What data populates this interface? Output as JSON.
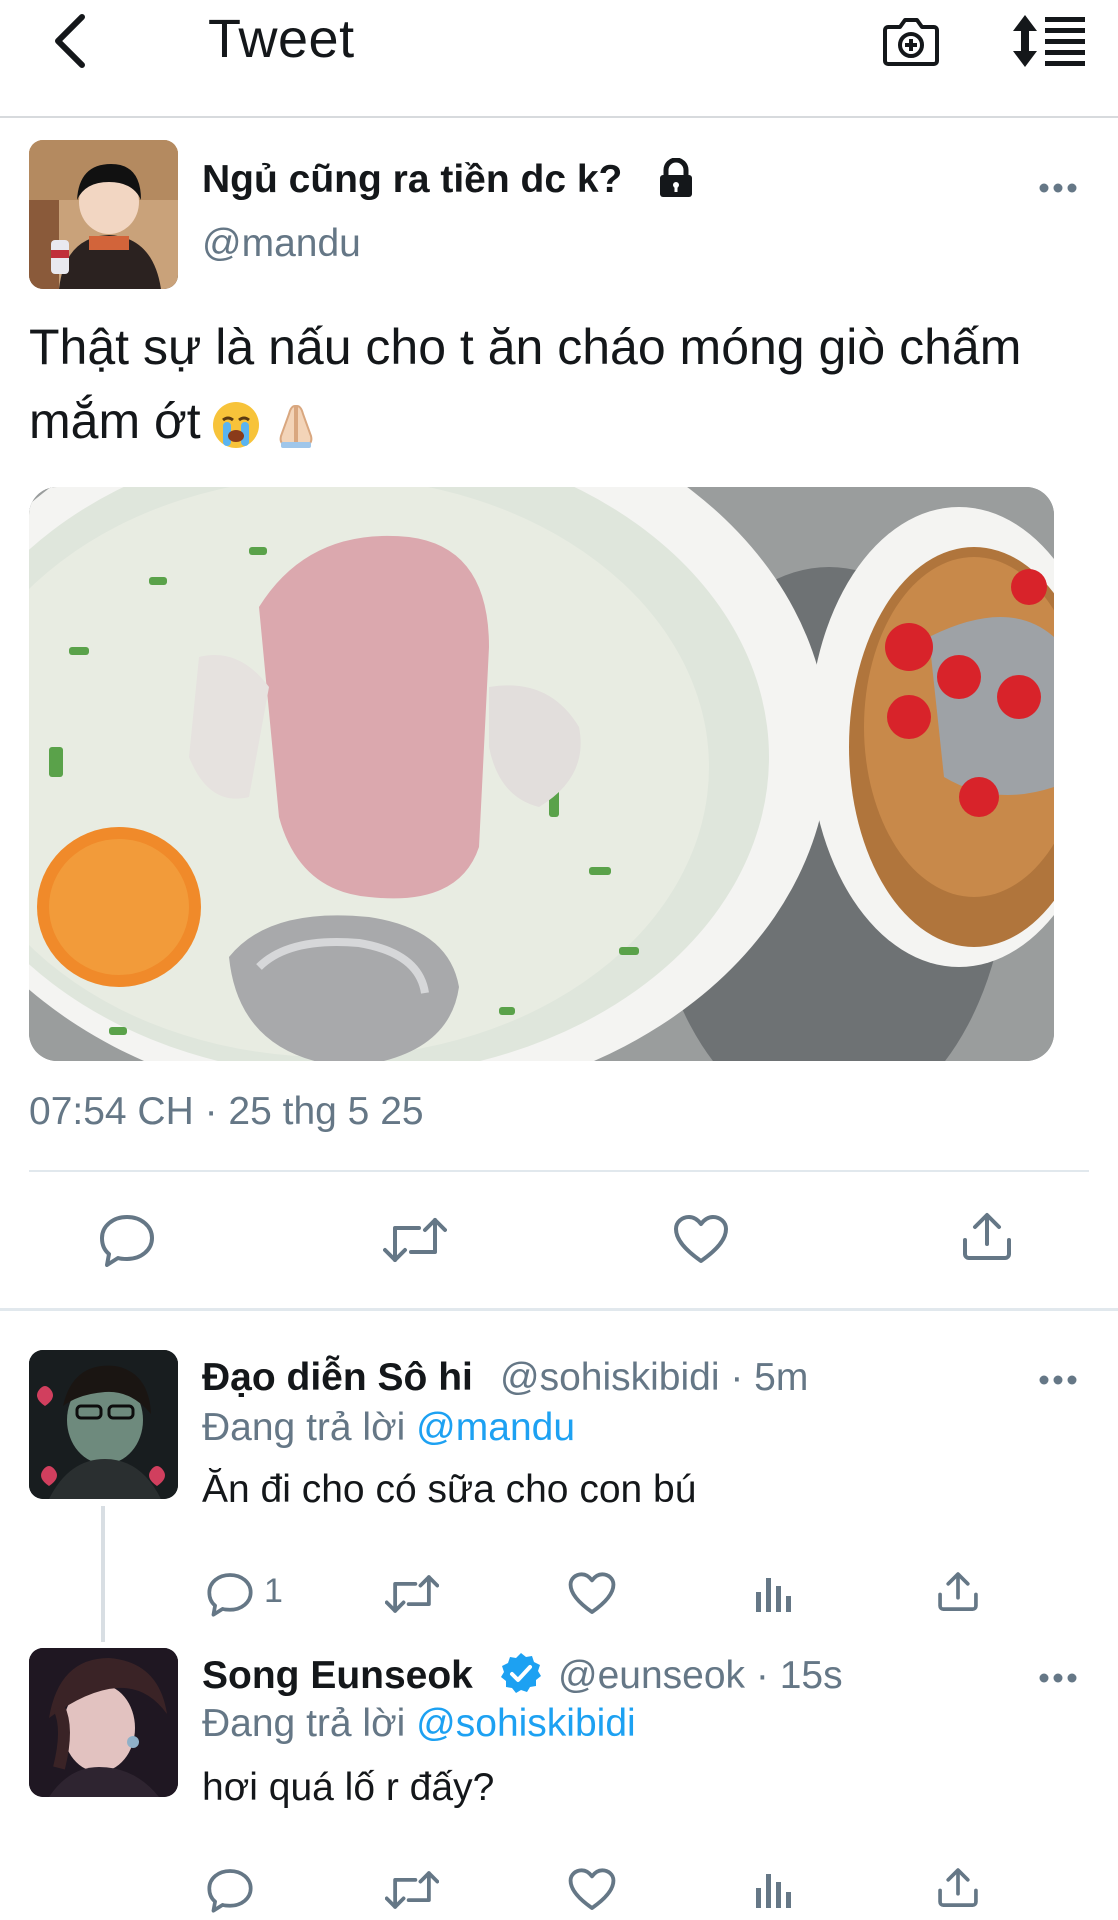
{
  "header": {
    "back_icon": "chevron-left-icon",
    "title": "Tweet",
    "camera_icon": "camera-plus-icon",
    "sort_icon": "sort-lines-icon"
  },
  "tweet": {
    "author_name": "Ngủ cũng ra tiền dc k?",
    "locked": true,
    "handle": "@mandu",
    "text": "Thật sự là nấu cho t ăn cháo móng giò chấm mắm ớt",
    "emojis": [
      "crying-face",
      "folded-hands"
    ],
    "timestamp": "07:54 CH · 25 thg 5 25",
    "actions": [
      "reply-icon",
      "retweet-icon",
      "like-icon",
      "share-icon"
    ]
  },
  "replies": [
    {
      "author_name": "Đạo diễn Sô hi",
      "meta": "@sohiskibidi · 5m",
      "replying_prefix": "Đang trả lời ",
      "replying_to": "@mandu",
      "text": "Ăn đi cho có sữa cho con bú",
      "reply_count": "1"
    },
    {
      "author_name": "Song Eunseok",
      "verified": true,
      "meta": "@eunseok · 15s",
      "replying_prefix": "Đang trả lời ",
      "replying_to": "@sohiskibidi",
      "text": "hơi quá lố r đấy?",
      "reply_count": ""
    }
  ],
  "colors": {
    "accent": "#1da1f2",
    "text_primary": "#14171a",
    "text_secondary": "#657786",
    "divider": "#e1e8ed"
  }
}
